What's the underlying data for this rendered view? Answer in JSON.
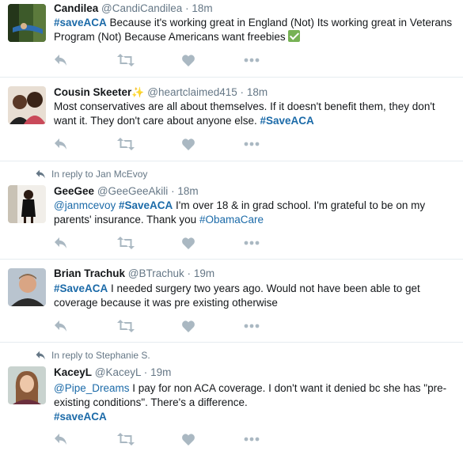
{
  "tweets": [
    {
      "name": "Candilea",
      "handle": "@CandiCandilea",
      "time": "18m",
      "text_parts": [
        "#saveACA",
        " Because it's working great in England (Not) Its working great in Veterans Program (Not) Because Americans want freebies"
      ],
      "emoji": "white-check-mark"
    },
    {
      "name": "Cousin Skeeter",
      "handle": "@heartclaimed415",
      "time": "18m",
      "text_parts": [
        "Most conservatives are all about themselves. If it doesn't benefit them, they don't want it. They don't care about anyone else. ",
        "#SaveACA"
      ],
      "emoji": "sparkles"
    },
    {
      "reply_to": "In reply to Jan McEvoy",
      "name": "GeeGee",
      "handle": "@GeeGeeAkili",
      "time": "18m",
      "text_parts": [
        "@janmcevoy",
        " ",
        "#SaveACA",
        " I'm over 18 & in grad school. I'm grateful to be on my parents' insurance. Thank you ",
        "#ObamaCare"
      ]
    },
    {
      "name": "Brian Trachuk",
      "handle": "@BTrachuk",
      "time": "19m",
      "text_parts": [
        "#SaveACA",
        " I needed surgery two years ago. Would not have been able to get coverage because it was pre existing otherwise"
      ]
    },
    {
      "reply_to": "In reply to Stephanie S.",
      "name": "KaceyL",
      "handle": "@KaceyL",
      "time": "19m",
      "text_parts": [
        "@Pipe_Dreams",
        "  I pay for non ACA coverage. I don't want it denied bc she has \"pre-existing conditions\".  There's a difference.",
        "#saveACA"
      ]
    }
  ],
  "separator": "·",
  "icons": [
    "reply-icon",
    "retweet-icon",
    "like-icon",
    "more-icon"
  ],
  "colors": {
    "link": "#1b6aa8",
    "muted": "#657786",
    "icon": "#aab8c2",
    "border": "#e6ecf0"
  }
}
